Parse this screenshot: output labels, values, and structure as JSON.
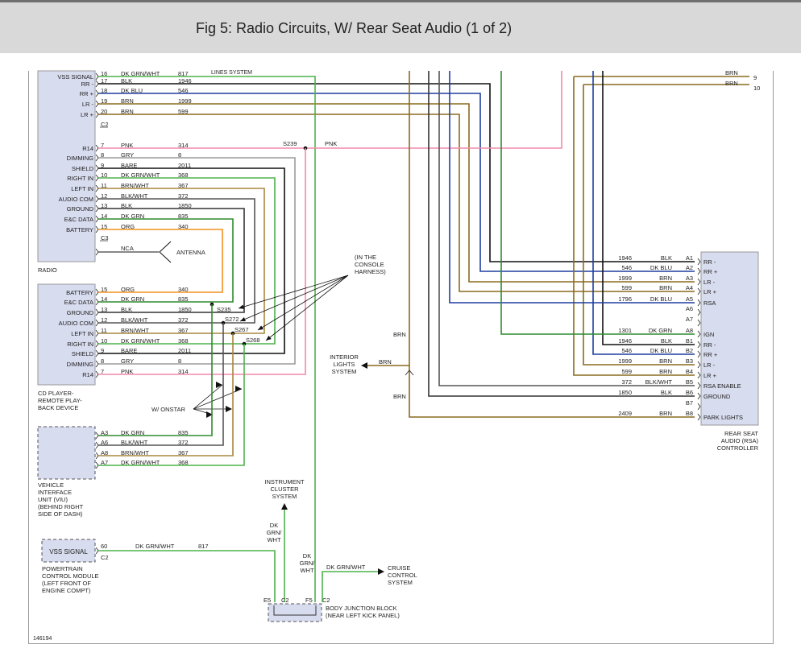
{
  "header": {
    "title": "Fig 5: Radio Circuits, W/ Rear Seat Audio (1 of 2)"
  },
  "figure_id": "146194",
  "radio": {
    "name": "RADIO",
    "c1_pins": [
      {
        "label": "VSS SIGNAL",
        "pin": "16",
        "color": "DK GRN/WHT",
        "circuit": "817"
      },
      {
        "label": "RR -",
        "pin": "17",
        "color": "BLK",
        "circuit": "1946"
      },
      {
        "label": "RR +",
        "pin": "18",
        "color": "DK BLU",
        "circuit": "546"
      },
      {
        "label": "LR -",
        "pin": "19",
        "color": "BRN",
        "circuit": "1999"
      },
      {
        "label": "LR +",
        "pin": "20",
        "color": "BRN",
        "circuit": "599"
      }
    ],
    "c2_label": "C2",
    "c2_pins": [
      {
        "label": "R14",
        "pin": "7",
        "color": "PNK",
        "circuit": "314"
      },
      {
        "label": "DIMMING",
        "pin": "8",
        "color": "GRY",
        "circuit": "8"
      },
      {
        "label": "SHIELD",
        "pin": "9",
        "color": "BARE",
        "circuit": "2011"
      },
      {
        "label": "RIGHT IN",
        "pin": "10",
        "color": "DK GRN/WHT",
        "circuit": "368"
      },
      {
        "label": "LEFT IN",
        "pin": "11",
        "color": "BRN/WHT",
        "circuit": "367"
      },
      {
        "label": "AUDIO COM",
        "pin": "12",
        "color": "BLK/WHT",
        "circuit": "372"
      },
      {
        "label": "GROUND",
        "pin": "13",
        "color": "BLK",
        "circuit": "1850"
      },
      {
        "label": "E&C DATA",
        "pin": "14",
        "color": "DK GRN",
        "circuit": "835"
      },
      {
        "label": "BATTERY",
        "pin": "15",
        "color": "ORG",
        "circuit": "340"
      }
    ],
    "c3_label": "C3",
    "nca": "NCA",
    "antenna": "ANTENNA",
    "lines_system": "LINES SYSTEM"
  },
  "cd_player": {
    "name_lines": [
      "CD PLAYER-",
      "REMOTE PLAY-",
      "BACK DEVICE"
    ],
    "pins": [
      {
        "label": "BATTERY",
        "pin": "15",
        "color": "ORG",
        "circuit": "340"
      },
      {
        "label": "E&C DATA",
        "pin": "14",
        "color": "DK GRN",
        "circuit": "835"
      },
      {
        "label": "GROUND",
        "pin": "13",
        "color": "BLK",
        "circuit": "1850"
      },
      {
        "label": "AUDIO COM",
        "pin": "12",
        "color": "BLK/WHT",
        "circuit": "372"
      },
      {
        "label": "LEFT IN",
        "pin": "11",
        "color": "BRN/WHT",
        "circuit": "367"
      },
      {
        "label": "RIGHT IN",
        "pin": "10",
        "color": "DK GRN/WHT",
        "circuit": "368"
      },
      {
        "label": "SHIELD",
        "pin": "9",
        "color": "BARE",
        "circuit": "2011"
      },
      {
        "label": "DIMMING",
        "pin": "8",
        "color": "GRY",
        "circuit": "8"
      },
      {
        "label": "R14",
        "pin": "7",
        "color": "PNK",
        "circuit": "314"
      }
    ]
  },
  "splices": {
    "s239": "S239",
    "s235": "S235",
    "s272": "S272",
    "s267": "S267",
    "s268": "S268",
    "pnk": "PNK",
    "console_note": [
      "(IN THE",
      "CONSOLE",
      "HARNESS)"
    ],
    "onstar": "W/ ONSTAR"
  },
  "viu": {
    "name_lines": [
      "VEHICLE",
      "INTERFACE",
      "UNIT (VIU)",
      "(BEHIND RIGHT",
      "SIDE OF DASH)"
    ],
    "pins": [
      {
        "pin": "A3",
        "color": "DK GRN",
        "circuit": "835"
      },
      {
        "pin": "A6",
        "color": "BLK/WHT",
        "circuit": "372"
      },
      {
        "pin": "A8",
        "color": "BRN/WHT",
        "circuit": "367"
      },
      {
        "pin": "A7",
        "color": "DK GRN/WHT",
        "circuit": "368"
      }
    ]
  },
  "pcm": {
    "box_label": "VSS SIGNAL",
    "pin": "60",
    "connector": "C2",
    "color": "DK GRN/WHT",
    "circuit": "817",
    "name_lines": [
      "POWERTRAIN",
      "CONTROL MODULE",
      "(LEFT FRONT OF",
      "ENGINE COMPT)"
    ]
  },
  "instrument_cluster": {
    "name_lines": [
      "INSTRUMENT",
      "CLUSTER",
      "SYSTEM"
    ],
    "wire_lines": [
      "DK",
      "GRN/",
      "WHT"
    ]
  },
  "bjb": {
    "left_pin": "E5",
    "left_conn": "C2",
    "right_pin": "F5",
    "right_conn": "C2",
    "wire_lines": [
      "DK",
      "GRN/",
      "WHT"
    ],
    "name_lines": [
      "BODY JUNCTION BLOCK",
      "(NEAR LEFT KICK PANEL)"
    ]
  },
  "cruise": {
    "wire": "DK GRN/WHT",
    "name_lines": [
      "CRUISE",
      "CONTROL",
      "SYSTEM"
    ]
  },
  "interior": {
    "name_lines": [
      "INTERIOR",
      "LIGHTS",
      "SYSTEM"
    ],
    "brn_labels": [
      "BRN",
      "BRN",
      "BRN"
    ]
  },
  "top_right": {
    "wires": [
      {
        "color": "BRN",
        "pin": "9"
      },
      {
        "color": "BRN",
        "pin": "10"
      }
    ]
  },
  "rsa": {
    "name_lines": [
      "REAR SEAT",
      "AUDIO (RSA)",
      "CONTROLLER"
    ],
    "pins": [
      {
        "circuit": "1946",
        "color": "BLK",
        "pin": "A1",
        "label": "RR -"
      },
      {
        "circuit": "546",
        "color": "DK BLU",
        "pin": "A2",
        "label": "RR +"
      },
      {
        "circuit": "1999",
        "color": "BRN",
        "pin": "A3",
        "label": "LR -"
      },
      {
        "circuit": "599",
        "color": "BRN",
        "pin": "A4",
        "label": "LR +"
      },
      {
        "circuit": "1796",
        "color": "DK BLU",
        "pin": "A5",
        "label": "RSA"
      },
      {
        "circuit": "",
        "color": "",
        "pin": "A6",
        "label": ""
      },
      {
        "circuit": "",
        "color": "",
        "pin": "A7",
        "label": ""
      },
      {
        "circuit": "1301",
        "color": "DK GRN",
        "pin": "A8",
        "label": "IGN"
      },
      {
        "circuit": "1946",
        "color": "BLK",
        "pin": "B1",
        "label": "RR -"
      },
      {
        "circuit": "546",
        "color": "DK BLU",
        "pin": "B2",
        "label": "RR +"
      },
      {
        "circuit": "1999",
        "color": "BRN",
        "pin": "B3",
        "label": "LR -"
      },
      {
        "circuit": "599",
        "color": "BRN",
        "pin": "B4",
        "label": "LR +"
      },
      {
        "circuit": "372",
        "color": "BLK/WHT",
        "pin": "B5",
        "label": "RSA ENABLE"
      },
      {
        "circuit": "1850",
        "color": "BLK",
        "pin": "B6",
        "label": "GROUND"
      },
      {
        "circuit": "",
        "color": "",
        "pin": "B7",
        "label": ""
      },
      {
        "circuit": "2409",
        "color": "BRN",
        "pin": "B8",
        "label": "PARK LIGHTS"
      }
    ]
  },
  "wire_colors": {
    "DK GRN/WHT": "#4db34d",
    "BLK": "#111111",
    "DK BLU": "#1f3fa0",
    "BRN": "#8a6a1e",
    "PNK": "#f08aa8",
    "GRY": "#9c9c9c",
    "BARE": "#222222",
    "BRN/WHT": "#a8873f",
    "BLK/WHT": "#555555",
    "DK GRN": "#2e8b2e",
    "ORG": "#f0901e"
  }
}
